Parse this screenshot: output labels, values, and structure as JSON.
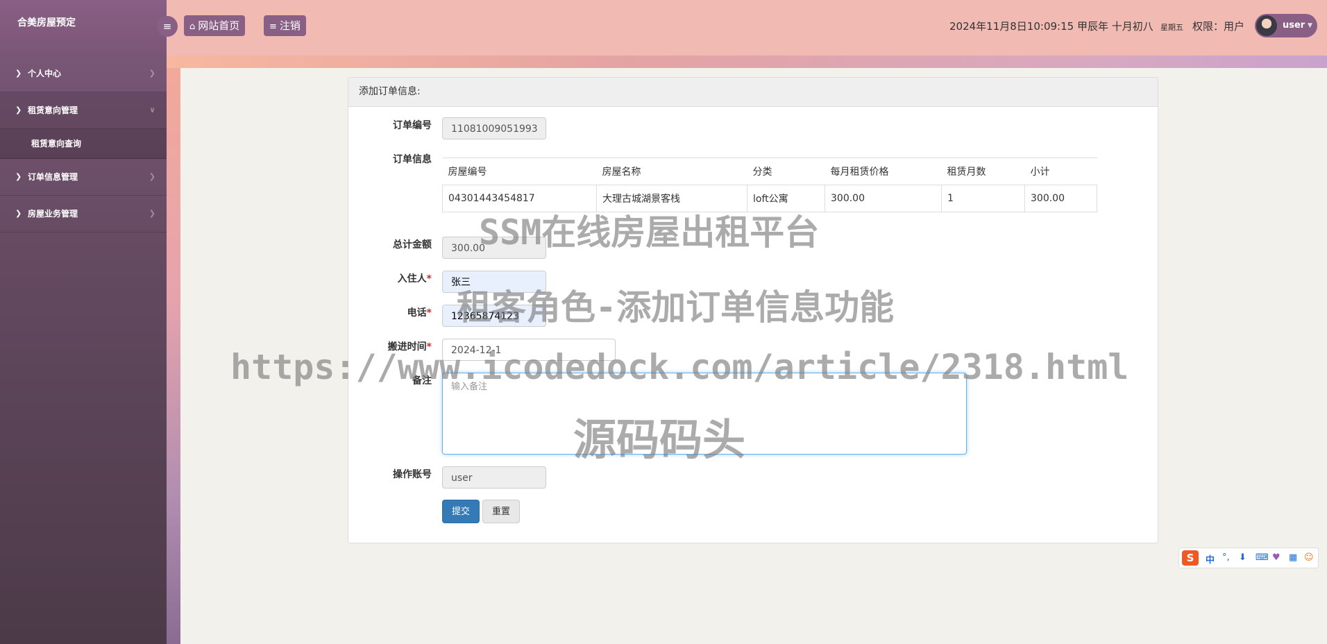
{
  "app": {
    "brand": "合美房屋预定"
  },
  "sidebar": {
    "items": [
      {
        "label": "个人中心"
      },
      {
        "label": "租赁意向管理"
      },
      {
        "label": "订单信息管理"
      },
      {
        "label": "房屋业务管理"
      }
    ],
    "sub_items": [
      {
        "label": "租赁意向查询"
      }
    ]
  },
  "header": {
    "home_label": "网站首页",
    "logout_label": "注销",
    "datetime": "2024年11月8日10:09:15 甲辰年 十月初八",
    "weekday": "星期五",
    "permission": "权限：用户",
    "username": "user"
  },
  "form": {
    "title": "添加订单信息:",
    "order_no_label": "订单编号",
    "order_no_value": "11081009051993",
    "order_info_label": "订单信息",
    "table": {
      "headers": [
        "房屋编号",
        "房屋名称",
        "分类",
        "每月租赁价格",
        "租赁月数",
        "小计"
      ],
      "rows": [
        [
          "04301443454817",
          "大理古城湖景客栈",
          "loft公寓",
          "300.00",
          "1",
          "300.00"
        ]
      ]
    },
    "total_label": "总计金额",
    "total_value": "300.00",
    "tenant_label": "入住人",
    "tenant_value": "张三",
    "phone_label": "电话",
    "phone_value": "12365874123",
    "movein_label": "搬进时间",
    "movein_value": "2024-12-1",
    "remark_label": "备注",
    "remark_placeholder": "输入备注",
    "account_label": "操作账号",
    "account_value": "user",
    "required_mark": "*",
    "submit_label": "提交",
    "reset_label": "重置"
  },
  "watermark": {
    "line1": "SSM在线房屋出租平台",
    "line2": "租客角色-添加订单信息功能",
    "line3": "https://www.icodedock.com/article/2318.html",
    "line4": "源码码头"
  },
  "ime": {
    "mode": "中"
  }
}
